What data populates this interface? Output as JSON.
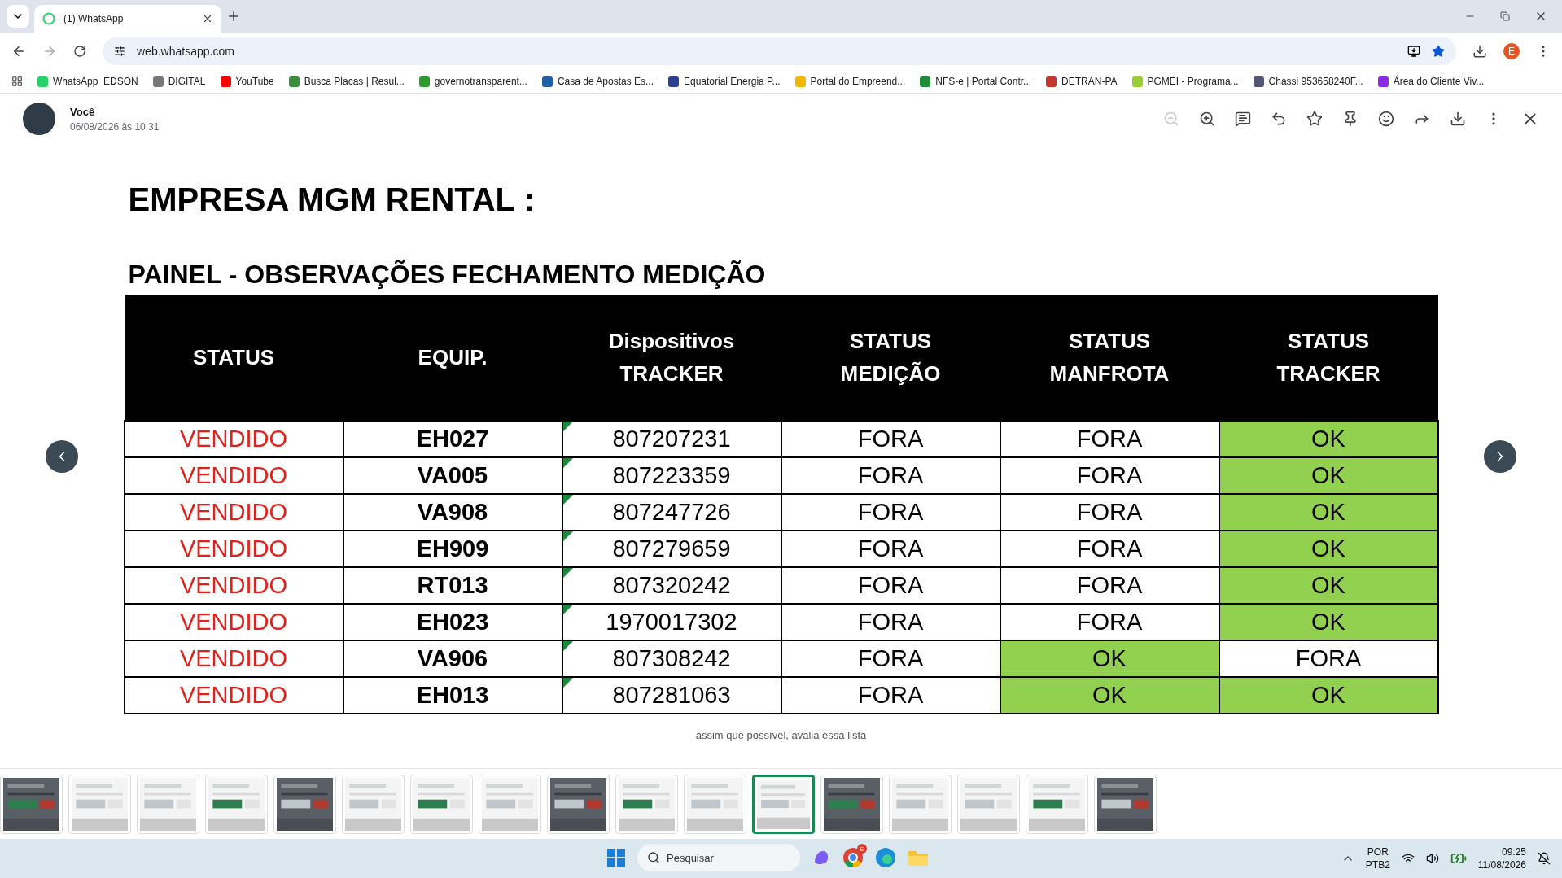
{
  "browser": {
    "tabs": [
      {
        "title": "(1) WhatsApp",
        "selected": true
      }
    ],
    "url": "web.whatsapp.com",
    "profile": "E",
    "bookmarks": [
      {
        "label": "WhatsApp  EDSON",
        "color": "#25d366"
      },
      {
        "label": "DIGITAL",
        "color": "#777777"
      },
      {
        "label": "YouTube",
        "color": "#ff0000"
      },
      {
        "label": "Busca Placas | Resul...",
        "color": "#3a8f3a"
      },
      {
        "label": "governotransparent...",
        "color": "#2e9a2e"
      },
      {
        "label": "Casa de Apostas Es...",
        "color": "#1f5fa8"
      },
      {
        "label": "Equatorial Energia P...",
        "color": "#2a3f8f"
      },
      {
        "label": "Portal do Empreend...",
        "color": "#f2b705"
      },
      {
        "label": "NFS-e | Portal Contr...",
        "color": "#1e8c3a"
      },
      {
        "label": "DETRAN-PA",
        "color": "#c0392b"
      },
      {
        "label": "PGMEI - Programa...",
        "color": "#9acd32"
      },
      {
        "label": "Chassi 953658240F...",
        "color": "#555577"
      },
      {
        "label": "Área do Cliente Viv...",
        "color": "#8a2be2"
      }
    ]
  },
  "viewer": {
    "sender": "Você",
    "date": "06/08/2026 às 10:31",
    "caption": "assim que possível, avalia essa lista",
    "image": {
      "title": "EMPRESA MGM RENTAL :",
      "subtitle": "PAINEL - OBSERVAÇÕES FECHAMENTO MEDIÇÃO",
      "columns": [
        [
          "STATUS"
        ],
        [
          "EQUIP."
        ],
        [
          "Dispositivos",
          "TRACKER"
        ],
        [
          "STATUS",
          "MEDIÇÃO"
        ],
        [
          "STATUS",
          "MANFROTA"
        ],
        [
          "STATUS",
          "TRACKER"
        ]
      ],
      "rows": [
        {
          "status": "VENDIDO",
          "equip": "EH027",
          "tracker": "807207231",
          "medicao": {
            "text": "FORA",
            "highlighted": false
          },
          "manfrota": {
            "text": "FORA",
            "highlighted": false
          },
          "tracker_status": {
            "text": "OK",
            "highlighted": true
          }
        },
        {
          "status": "VENDIDO",
          "equip": "VA005",
          "tracker": "807223359",
          "medicao": {
            "text": "FORA",
            "highlighted": false
          },
          "manfrota": {
            "text": "FORA",
            "highlighted": false
          },
          "tracker_status": {
            "text": "OK",
            "highlighted": true
          }
        },
        {
          "status": "VENDIDO",
          "equip": "VA908",
          "tracker": "807247726",
          "medicao": {
            "text": "FORA",
            "highlighted": false
          },
          "manfrota": {
            "text": "FORA",
            "highlighted": false
          },
          "tracker_status": {
            "text": "OK",
            "highlighted": true
          }
        },
        {
          "status": "VENDIDO",
          "equip": "EH909",
          "tracker": "807279659",
          "medicao": {
            "text": "FORA",
            "highlighted": false
          },
          "manfrota": {
            "text": "FORA",
            "highlighted": false
          },
          "tracker_status": {
            "text": "OK",
            "highlighted": true
          }
        },
        {
          "status": "VENDIDO",
          "equip": "RT013",
          "tracker": "807320242",
          "medicao": {
            "text": "FORA",
            "highlighted": false
          },
          "manfrota": {
            "text": "FORA",
            "highlighted": false
          },
          "tracker_status": {
            "text": "OK",
            "highlighted": true
          }
        },
        {
          "status": "VENDIDO",
          "equip": "EH023",
          "tracker": "1970017302",
          "medicao": {
            "text": "FORA",
            "highlighted": false
          },
          "manfrota": {
            "text": "FORA",
            "highlighted": false
          },
          "tracker_status": {
            "text": "OK",
            "highlighted": true
          }
        },
        {
          "status": "VENDIDO",
          "equip": "VA906",
          "tracker": "807308242",
          "medicao": {
            "text": "FORA",
            "highlighted": false
          },
          "manfrota": {
            "text": "OK",
            "highlighted": true
          },
          "tracker_status": {
            "text": "FORA",
            "highlighted": false
          }
        },
        {
          "status": "VENDIDO",
          "equip": "EH013",
          "tracker": "807281063",
          "medicao": {
            "text": "FORA",
            "highlighted": false
          },
          "manfrota": {
            "text": "OK",
            "highlighted": true
          },
          "tracker_status": {
            "text": "OK",
            "highlighted": true
          }
        }
      ]
    },
    "thumbnails": [
      {
        "kind": "picture",
        "selected": false
      },
      {
        "kind": "picture",
        "selected": false
      },
      {
        "kind": "picture",
        "selected": false
      },
      {
        "kind": "picture",
        "selected": false
      },
      {
        "kind": "picture",
        "selected": false
      },
      {
        "kind": "picture",
        "selected": false
      },
      {
        "kind": "picture",
        "selected": false
      },
      {
        "kind": "picture",
        "selected": false
      },
      {
        "kind": "picture",
        "selected": false
      },
      {
        "kind": "picture",
        "selected": false
      },
      {
        "kind": "picture",
        "selected": false
      },
      {
        "kind": "picture",
        "selected": true
      },
      {
        "kind": "picture",
        "selected": false
      },
      {
        "kind": "picture",
        "selected": false
      },
      {
        "kind": "picture",
        "selected": false
      },
      {
        "kind": "picture",
        "selected": false
      },
      {
        "kind": "picture",
        "selected": false
      }
    ]
  },
  "taskbar": {
    "search_placeholder": "Pesquisar",
    "chrome_badge": "E",
    "language": "POR",
    "layout": "PTB2",
    "time": "09:25",
    "date": "11/08/2026"
  }
}
